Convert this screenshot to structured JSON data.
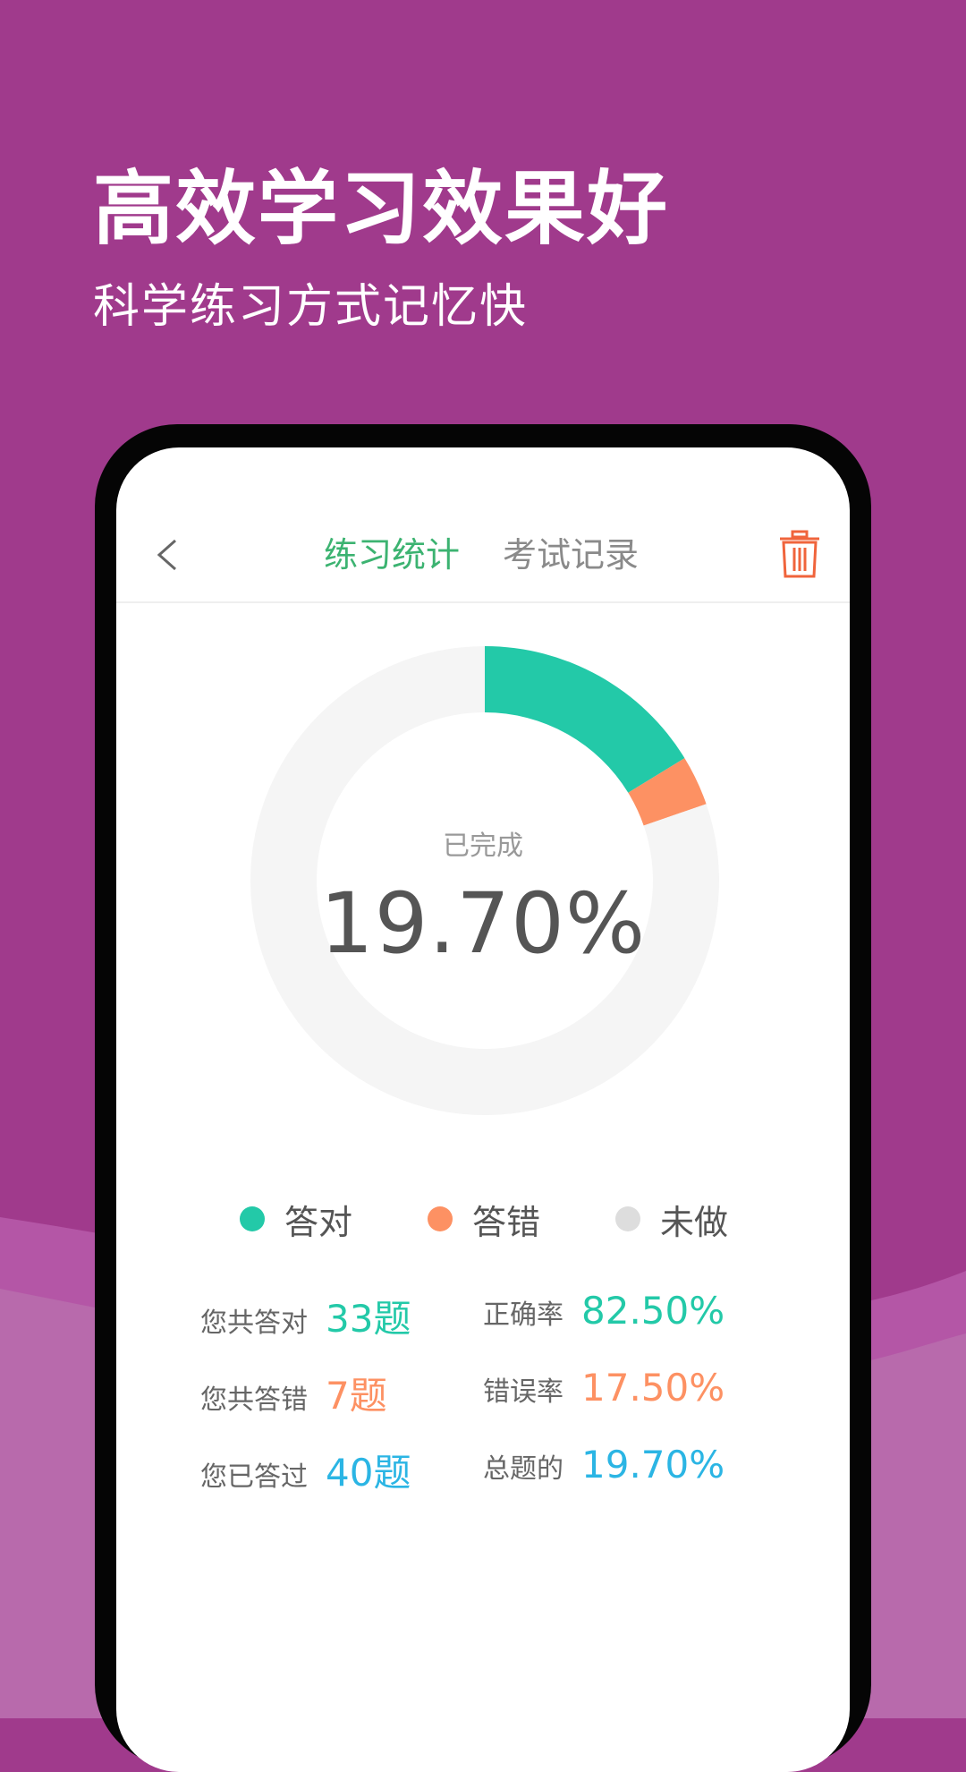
{
  "hero": {
    "title": "高效学习效果好",
    "subtitle": "科学练习方式记忆快"
  },
  "navbar": {
    "tabs": [
      {
        "label": "练习统计",
        "active": true
      },
      {
        "label": "考试记录",
        "active": false
      }
    ],
    "back_icon": "chevron-left-icon",
    "delete_icon": "trash-icon"
  },
  "chart_data": {
    "type": "pie",
    "style": "donut",
    "center_label": "已完成",
    "center_value": "19.70%",
    "slices": [
      {
        "name": "答对",
        "percent": 16.25,
        "color": "#23c9a8"
      },
      {
        "name": "答错",
        "percent": 3.45,
        "color": "#fd9163"
      },
      {
        "name": "未做",
        "percent": 80.3,
        "color": "#f5f5f5"
      }
    ]
  },
  "legend": [
    {
      "label": "答对",
      "color": "#23c9a8"
    },
    {
      "label": "答错",
      "color": "#fd9163"
    },
    {
      "label": "未做",
      "color": "#dddddd"
    }
  ],
  "stats": [
    {
      "label": "您共答对",
      "value": "33题",
      "color": "#23c9a8"
    },
    {
      "label": "正确率",
      "value": "82.50%",
      "color": "#23c9a8"
    },
    {
      "label": "您共答错",
      "value": "7题",
      "color": "#fd9163"
    },
    {
      "label": "错误率",
      "value": "17.50%",
      "color": "#fd9163"
    },
    {
      "label": "您已答过",
      "value": "40题",
      "color": "#2bb5e4"
    },
    {
      "label": "总题的",
      "value": "19.70%",
      "color": "#2bb5e4"
    }
  ],
  "colors": {
    "background": "#a03a8c",
    "tab_active": "#3cb371",
    "tab_inactive": "#8a8a8a",
    "delete": "#f0643c"
  }
}
